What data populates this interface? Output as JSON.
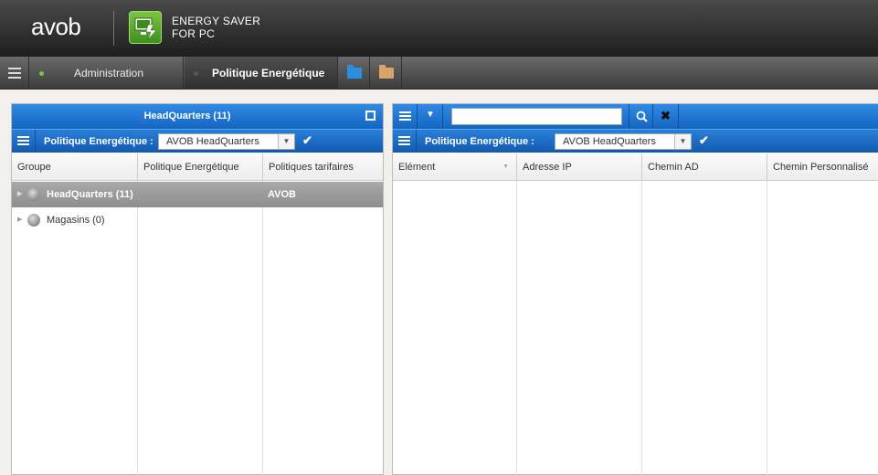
{
  "header": {
    "logo": "avob",
    "product_line1": "ENERGY SAVER",
    "product_line2": "FOR PC"
  },
  "nav": {
    "tabs": [
      {
        "label": "Administration",
        "status_color": "#7cc542"
      },
      {
        "label": "Politique Energétique",
        "status_color": "#555555"
      }
    ],
    "icons": [
      "folder-blue-icon",
      "folder-tan-icon"
    ]
  },
  "left_panel": {
    "title": "HeadQuarters (11)",
    "filter_label": "Politique Energétique :",
    "filter_value": "AVOB HeadQuarters",
    "columns": [
      "Groupe",
      "Politique Energétique",
      "Politiques tarifaires"
    ],
    "rows": [
      {
        "group": "HeadQuarters (11)",
        "policy": "",
        "tariff": "AVOB",
        "selected": true
      },
      {
        "group": "Magasins (0)",
        "policy": "",
        "tariff": "",
        "selected": false
      }
    ]
  },
  "right_panel": {
    "search_value": "",
    "filter_label": "Politique Energétique :",
    "filter_value": "AVOB HeadQuarters",
    "columns": [
      "Elément",
      "Adresse IP",
      "Chemin AD",
      "Chemin Personnalisé"
    ]
  },
  "colors": {
    "accent_blue": "#1e74d4",
    "header_dark": "#1e1e1e",
    "brand_green": "#7cc542"
  }
}
